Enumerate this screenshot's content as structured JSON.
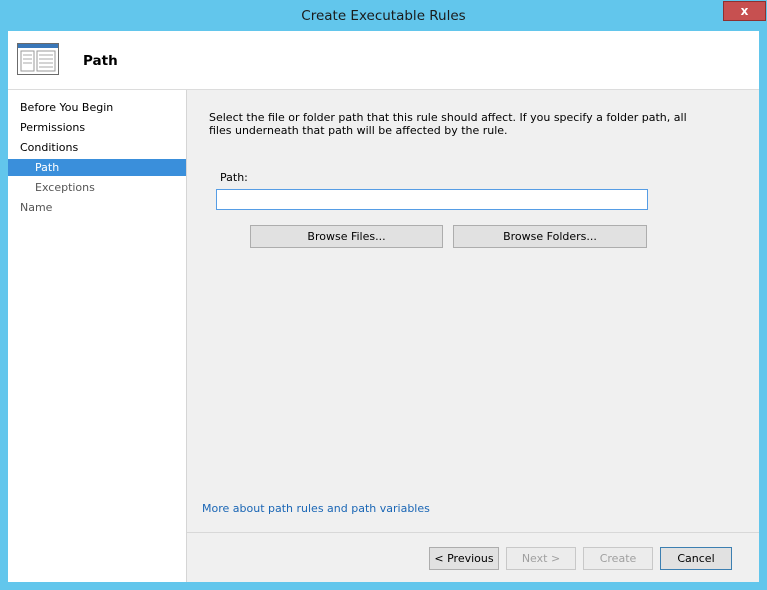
{
  "window": {
    "title": "Create Executable Rules",
    "close_label": "x"
  },
  "header": {
    "title": "Path",
    "icon": "window-list-icon"
  },
  "sidebar": {
    "items": [
      {
        "label": "Before You Begin"
      },
      {
        "label": "Permissions"
      },
      {
        "label": "Conditions"
      },
      {
        "label": "Path"
      },
      {
        "label": "Exceptions"
      },
      {
        "label": "Name"
      }
    ],
    "selected": "Path"
  },
  "content": {
    "description": "Select the file or folder path that this rule should affect. If you specify a folder path, all files underneath that path will be affected by the rule.",
    "path_label": "Path:",
    "path_value": "",
    "browse_files_label": "Browse Files...",
    "browse_folders_label": "Browse Folders...",
    "more_link": "More about path rules and path variables"
  },
  "footer": {
    "previous_label": "< Previous",
    "next_label": "Next >",
    "create_label": "Create",
    "cancel_label": "Cancel"
  },
  "colors": {
    "frame": "#62c6ec",
    "selection": "#3a8fdb",
    "link": "#1a66b5",
    "close": "#c75050"
  }
}
